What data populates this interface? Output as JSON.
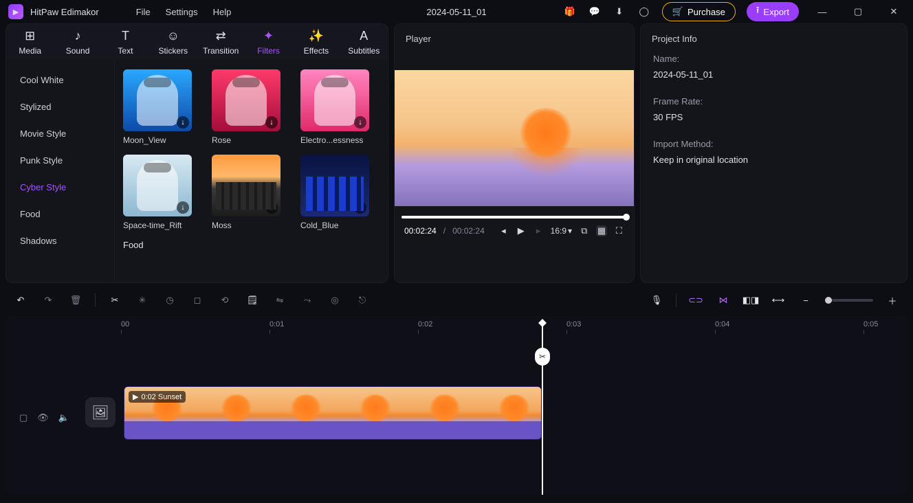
{
  "app": {
    "name": "HitPaw Edimakor"
  },
  "menu": {
    "file": "File",
    "settings": "Settings",
    "help": "Help"
  },
  "project_title": "2024-05-11_01",
  "header": {
    "purchase": "Purchase",
    "export": "Export"
  },
  "tabs": {
    "media": "Media",
    "sound": "Sound",
    "text": "Text",
    "stickers": "Stickers",
    "transition": "Transition",
    "filters": "Filters",
    "effects": "Effects",
    "subtitles": "Subtitles"
  },
  "categories": {
    "cool_white": "Cool White",
    "stylized": "Stylized",
    "movie": "Movie Style",
    "punk": "Punk Style",
    "cyber": "Cyber Style",
    "food": "Food",
    "shadows": "Shadows"
  },
  "filters": {
    "moon": "Moon_View",
    "rose": "Rose",
    "electro": "Electro...essness",
    "rift": "Space-time_Rift",
    "moss": "Moss",
    "cold": "Cold_Blue"
  },
  "section2": "Food",
  "player": {
    "title": "Player",
    "time_current": "00:02:24",
    "time_sep": " / ",
    "time_total": "00:02:24",
    "ratio": "16:9"
  },
  "info": {
    "title": "Project Info",
    "name_label": "Name:",
    "name_value": "2024-05-11_01",
    "framerate_label": "Frame Rate:",
    "framerate_value": "30 FPS",
    "import_label": "Import Method:",
    "import_value": "Keep in original location"
  },
  "ruler": {
    "t00": "00",
    "t01": "0:01",
    "t02": "0:02",
    "t03": "0:03",
    "t04": "0:04",
    "t05": "0:05"
  },
  "clip": {
    "label": "0:02 Sunset"
  }
}
